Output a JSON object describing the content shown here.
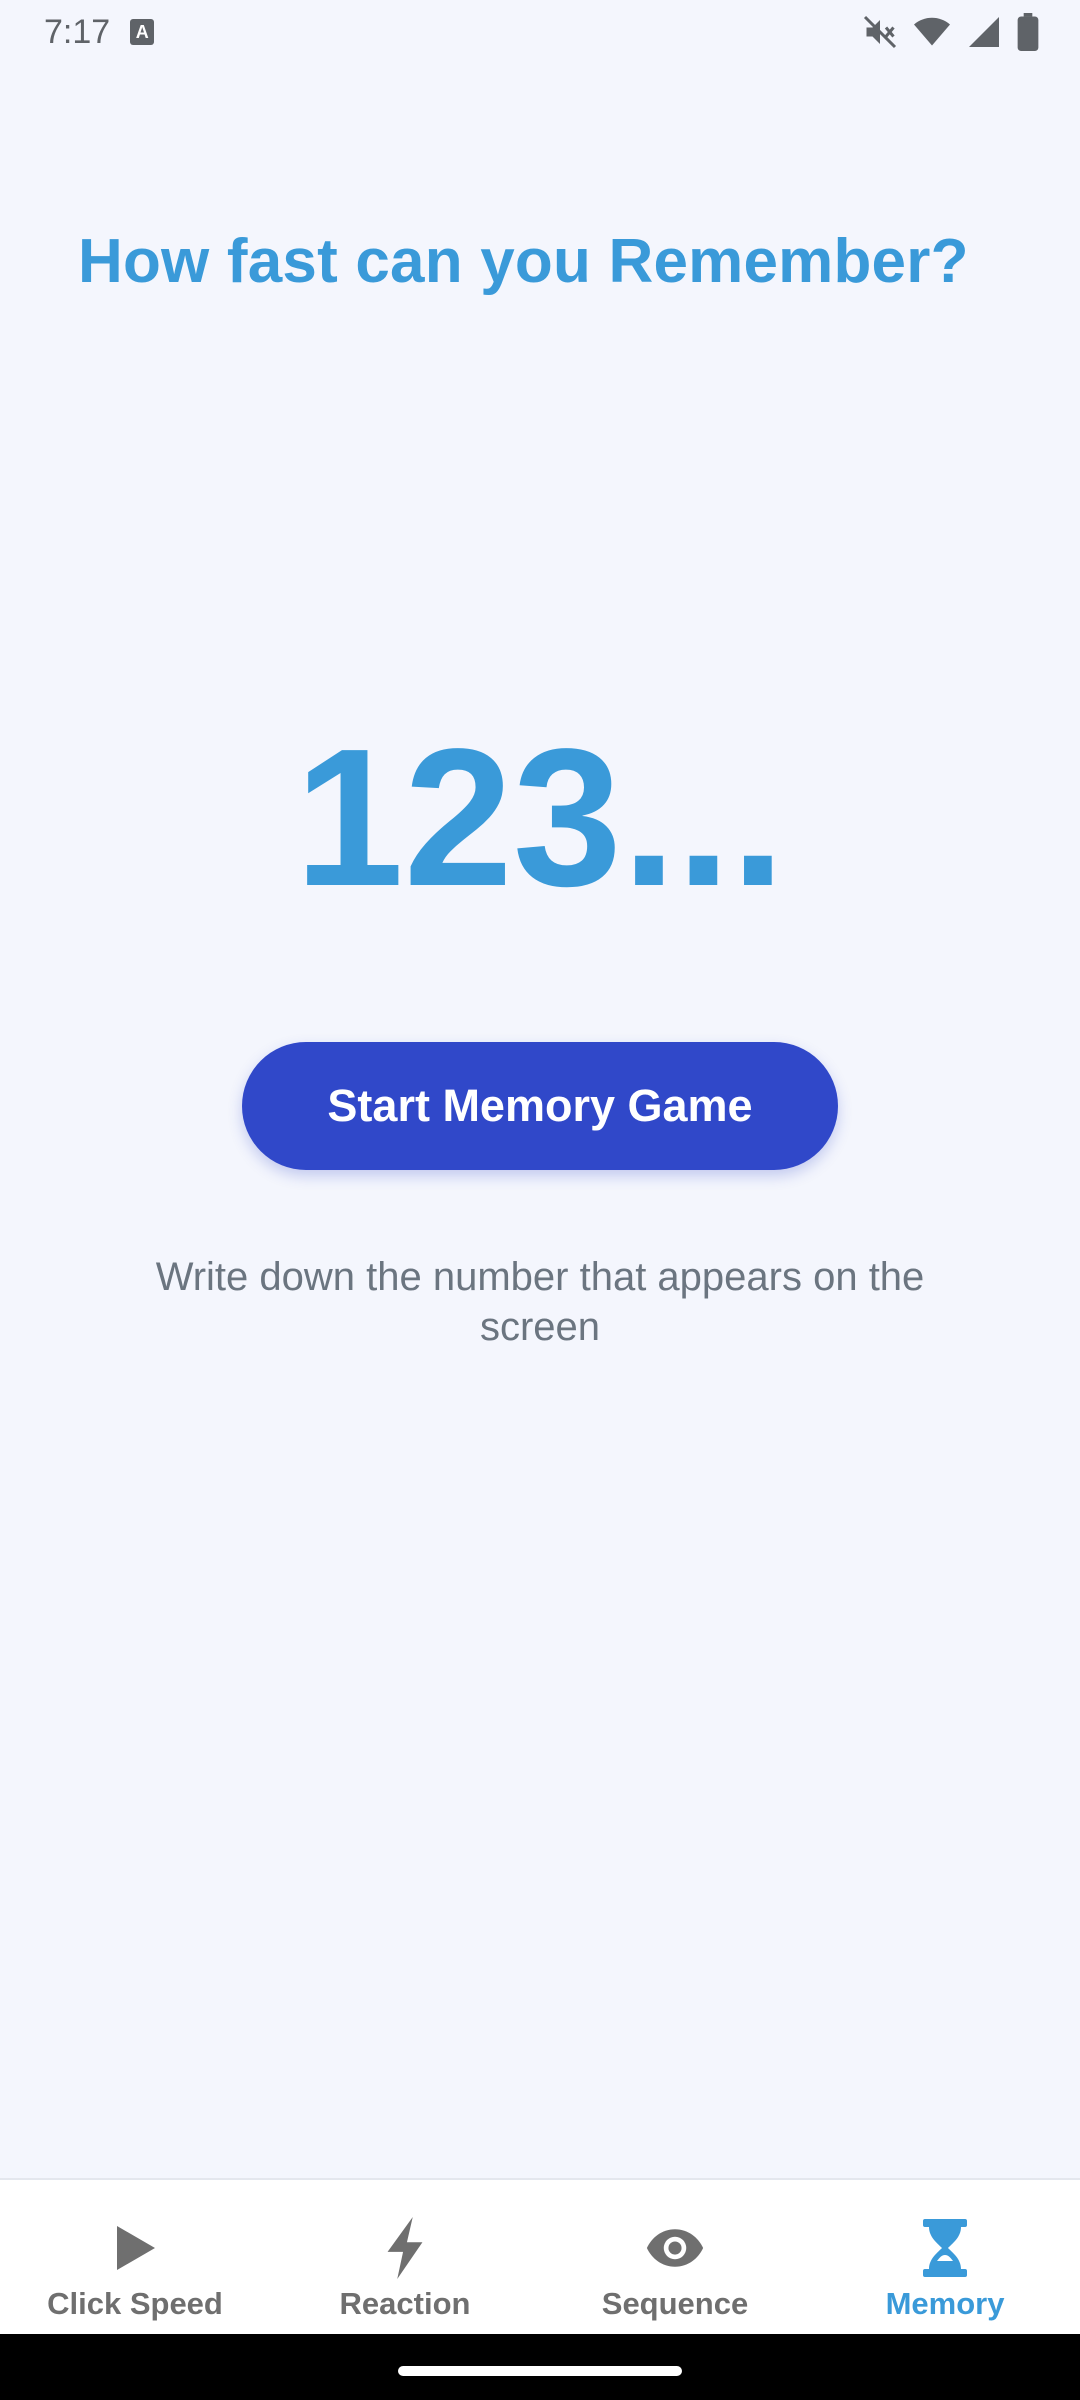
{
  "status_bar": {
    "time": "7:17",
    "notification_icon": "keyboard-a-icon",
    "icons": [
      "mute-icon",
      "wifi-icon",
      "signal-icon",
      "battery-icon"
    ]
  },
  "main": {
    "headline": "How fast can you Remember?",
    "display_number": "123...",
    "start_button_label": "Start Memory Game",
    "instruction": "Write down the number that appears on the screen"
  },
  "bottom_nav": {
    "items": [
      {
        "label": "Click Speed",
        "icon": "play-icon",
        "active": false
      },
      {
        "label": "Reaction",
        "icon": "bolt-icon",
        "active": false
      },
      {
        "label": "Sequence",
        "icon": "eye-icon",
        "active": false
      },
      {
        "label": "Memory",
        "icon": "hourglass-icon",
        "active": true
      }
    ]
  },
  "colors": {
    "accent": "#3a9ad9",
    "button": "#3048c9",
    "background": "#f4f6fd",
    "inactive_nav": "#6f6f6f",
    "text_muted": "#6b7580"
  }
}
